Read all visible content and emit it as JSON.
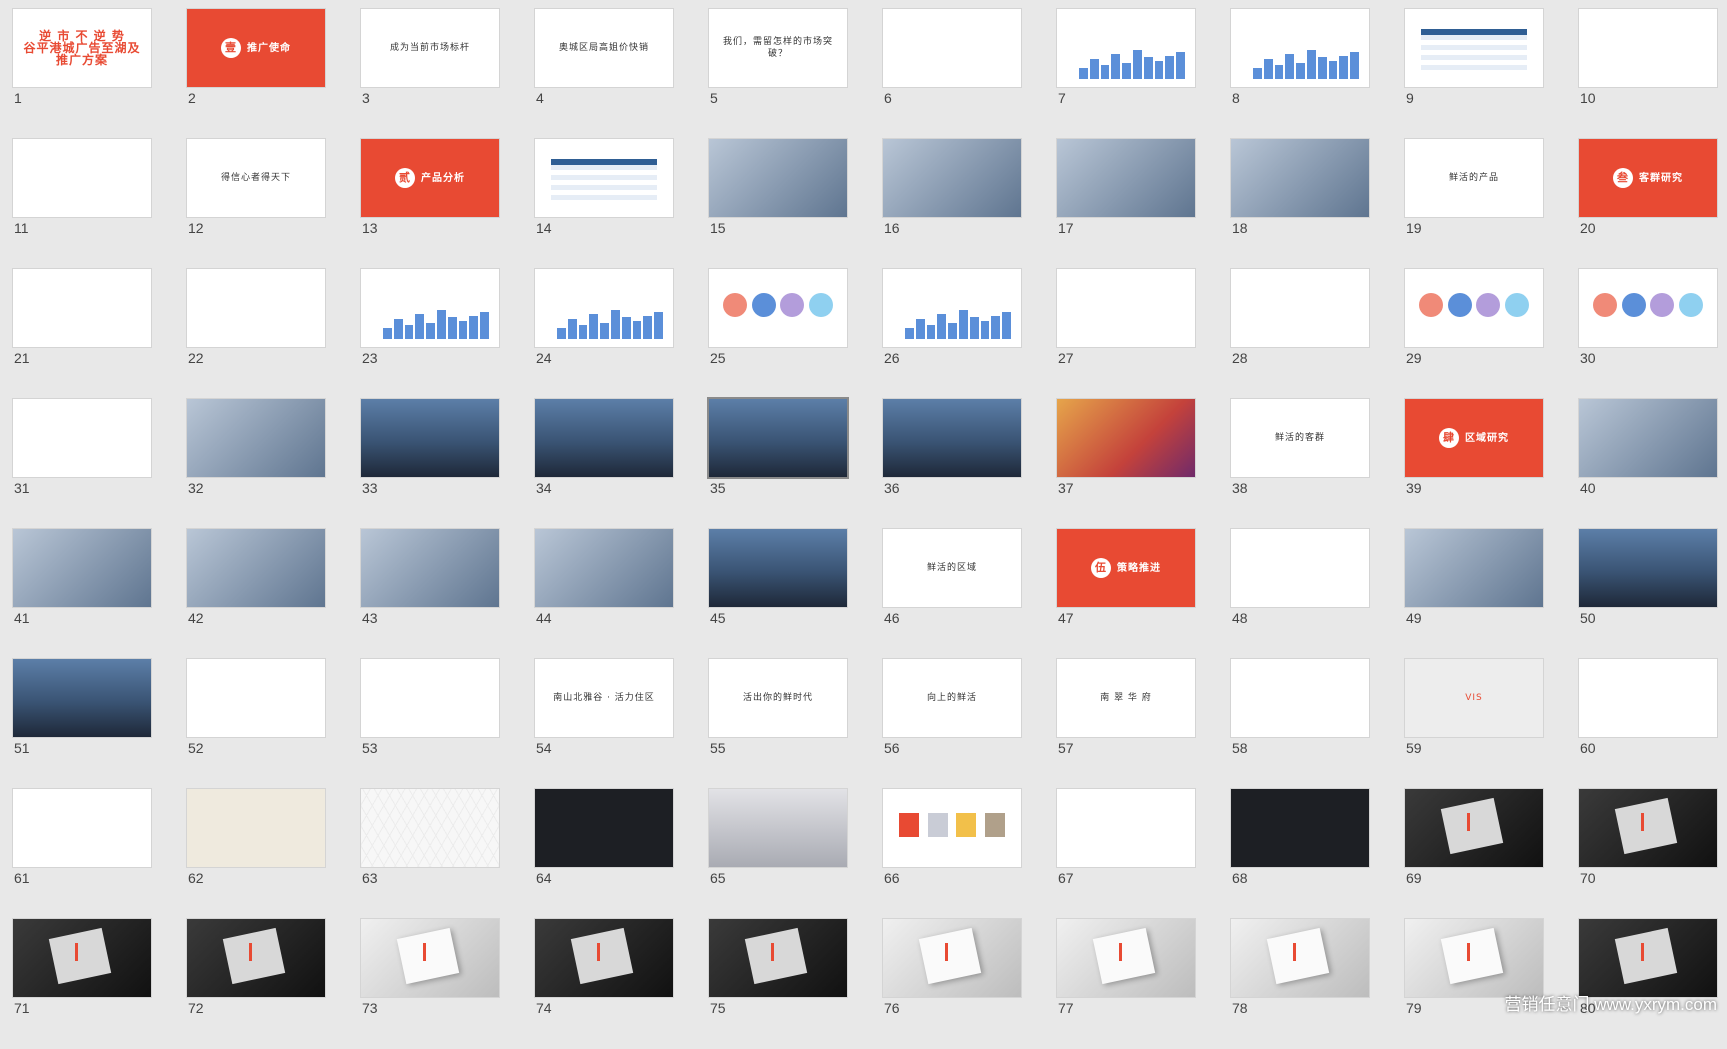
{
  "window": {
    "title": ""
  },
  "watermark": "营销任意门 www.yxrym.com",
  "selected_slide": 35,
  "accent_color": "#e84a33",
  "slides": [
    {
      "n": "1",
      "style": "s-bignum",
      "text": "逆 市 不 逆 势\n谷平港城广告至湖及推广方案"
    },
    {
      "n": "2",
      "style": "s-red",
      "badge": "壹",
      "text": "推广使命"
    },
    {
      "n": "3",
      "style": "s-text",
      "text": "成为当前市场标杆"
    },
    {
      "n": "4",
      "style": "s-text",
      "text": "奥城区局高姐价快销"
    },
    {
      "n": "5",
      "style": "s-text",
      "text": "我们，需留怎样的市场突破？"
    },
    {
      "n": "6",
      "style": "s-text",
      "text": "",
      "icon": "text-lines"
    },
    {
      "n": "7",
      "style": "s-chart",
      "text": ""
    },
    {
      "n": "8",
      "style": "s-chart",
      "text": ""
    },
    {
      "n": "9",
      "style": "s-table",
      "text": ""
    },
    {
      "n": "10",
      "style": "s-text",
      "text": ""
    },
    {
      "n": "11",
      "style": "s-text",
      "text": ""
    },
    {
      "n": "12",
      "style": "s-text",
      "text": "得信心者得天下"
    },
    {
      "n": "13",
      "style": "s-red",
      "badge": "贰",
      "text": "产品分析"
    },
    {
      "n": "14",
      "style": "s-table",
      "text": ""
    },
    {
      "n": "15",
      "style": "s-photo",
      "text": ""
    },
    {
      "n": "16",
      "style": "s-photo",
      "text": ""
    },
    {
      "n": "17",
      "style": "s-photo",
      "text": ""
    },
    {
      "n": "18",
      "style": "s-photo",
      "text": ""
    },
    {
      "n": "19",
      "style": "s-text",
      "text": "鲜活的产品"
    },
    {
      "n": "20",
      "style": "s-red",
      "badge": "叁",
      "text": "客群研究"
    },
    {
      "n": "21",
      "style": "s-text",
      "text": ""
    },
    {
      "n": "22",
      "style": "s-text",
      "text": ""
    },
    {
      "n": "23",
      "style": "s-chart",
      "text": ""
    },
    {
      "n": "24",
      "style": "s-chart",
      "text": ""
    },
    {
      "n": "25",
      "style": "s-circles",
      "text": ""
    },
    {
      "n": "26",
      "style": "s-chart",
      "text": ""
    },
    {
      "n": "27",
      "style": "s-text",
      "text": ""
    },
    {
      "n": "28",
      "style": "s-text",
      "text": ""
    },
    {
      "n": "29",
      "style": "s-circles",
      "text": ""
    },
    {
      "n": "30",
      "style": "s-circles",
      "text": ""
    },
    {
      "n": "31",
      "style": "s-text",
      "text": ""
    },
    {
      "n": "32",
      "style": "s-photo",
      "text": ""
    },
    {
      "n": "33",
      "style": "s-city",
      "text": ""
    },
    {
      "n": "34",
      "style": "s-city",
      "text": ""
    },
    {
      "n": "35",
      "style": "s-city",
      "text": ""
    },
    {
      "n": "36",
      "style": "s-city",
      "text": ""
    },
    {
      "n": "37",
      "style": "s-crowd",
      "text": ""
    },
    {
      "n": "38",
      "style": "s-text",
      "text": "鲜活的客群"
    },
    {
      "n": "39",
      "style": "s-red",
      "badge": "肆",
      "text": "区域研究"
    },
    {
      "n": "40",
      "style": "s-photo",
      "text": ""
    },
    {
      "n": "41",
      "style": "s-photo",
      "text": ""
    },
    {
      "n": "42",
      "style": "s-photo",
      "text": ""
    },
    {
      "n": "43",
      "style": "s-photo",
      "text": ""
    },
    {
      "n": "44",
      "style": "s-photo",
      "text": ""
    },
    {
      "n": "45",
      "style": "s-city",
      "text": ""
    },
    {
      "n": "46",
      "style": "s-text",
      "text": "鲜活的区域"
    },
    {
      "n": "47",
      "style": "s-red",
      "badge": "伍",
      "text": "策略推进"
    },
    {
      "n": "48",
      "style": "s-text",
      "text": ""
    },
    {
      "n": "49",
      "style": "s-photo",
      "text": ""
    },
    {
      "n": "50",
      "style": "s-city",
      "text": ""
    },
    {
      "n": "51",
      "style": "s-city",
      "text": ""
    },
    {
      "n": "52",
      "style": "s-text",
      "text": ""
    },
    {
      "n": "53",
      "style": "s-text",
      "text": ""
    },
    {
      "n": "54",
      "style": "s-text",
      "text": "南山北雅谷 · 活力住区"
    },
    {
      "n": "55",
      "style": "s-text",
      "text": "活出你的鲜时代"
    },
    {
      "n": "56",
      "style": "s-text",
      "text": "向上的鲜活"
    },
    {
      "n": "57",
      "style": "s-text",
      "text": "南 翠 华 府"
    },
    {
      "n": "58",
      "style": "s-text",
      "text": ""
    },
    {
      "n": "59",
      "style": "s-gray",
      "text": "VIS"
    },
    {
      "n": "60",
      "style": "s-text",
      "text": ""
    },
    {
      "n": "61",
      "style": "s-text",
      "text": ""
    },
    {
      "n": "62",
      "style": "s-cream",
      "text": ""
    },
    {
      "n": "63",
      "style": "s-pattern",
      "text": ""
    },
    {
      "n": "64",
      "style": "s-dark",
      "text": ""
    },
    {
      "n": "65",
      "style": "s-silver",
      "text": ""
    },
    {
      "n": "66",
      "style": "s-swatch",
      "text": ""
    },
    {
      "n": "67",
      "style": "s-text",
      "text": ""
    },
    {
      "n": "68",
      "style": "s-dark",
      "text": ""
    },
    {
      "n": "69",
      "style": "s-product",
      "text": ""
    },
    {
      "n": "70",
      "style": "s-product",
      "text": ""
    },
    {
      "n": "71",
      "style": "s-product",
      "text": ""
    },
    {
      "n": "72",
      "style": "s-product",
      "text": ""
    },
    {
      "n": "73",
      "style": "s-product light",
      "text": ""
    },
    {
      "n": "74",
      "style": "s-product",
      "text": ""
    },
    {
      "n": "75",
      "style": "s-product",
      "text": ""
    },
    {
      "n": "76",
      "style": "s-product light",
      "text": ""
    },
    {
      "n": "77",
      "style": "s-product light",
      "text": ""
    },
    {
      "n": "78",
      "style": "s-product light",
      "text": ""
    },
    {
      "n": "79",
      "style": "s-product light",
      "text": ""
    },
    {
      "n": "80",
      "style": "s-product",
      "text": ""
    }
  ]
}
